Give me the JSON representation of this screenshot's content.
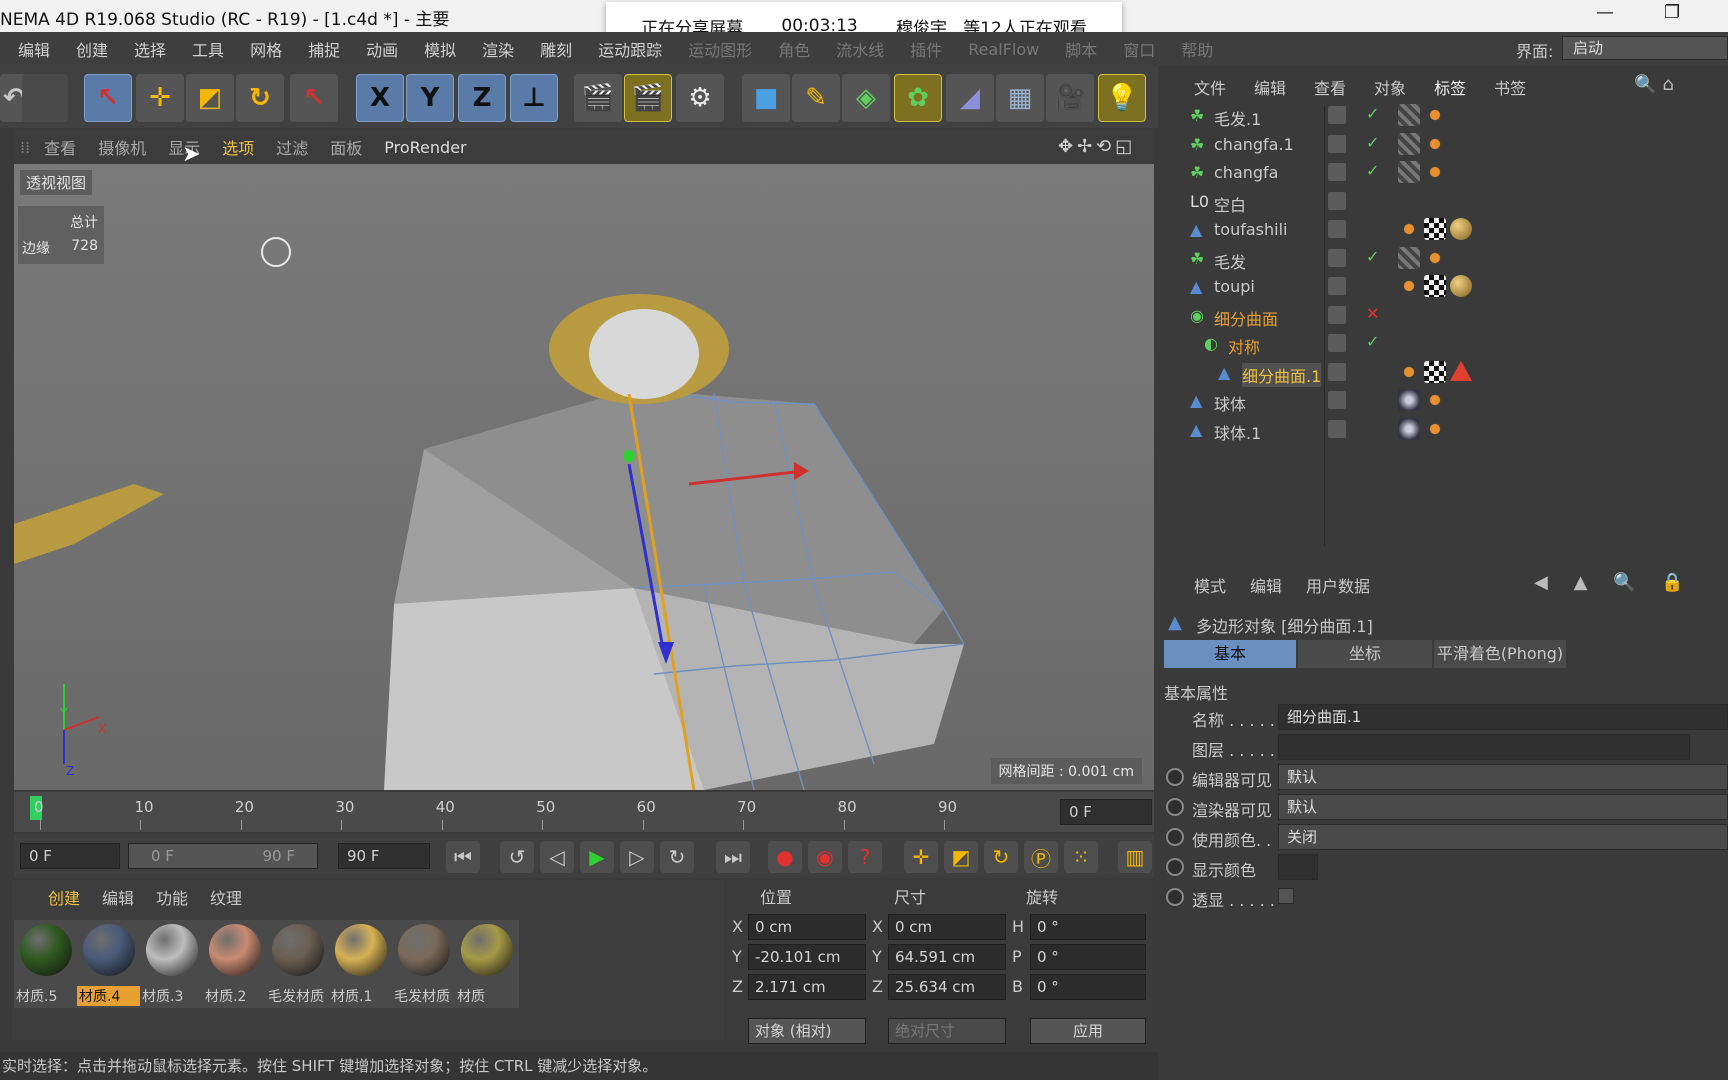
{
  "app": {
    "title": "NEMA 4D R19.068 Studio (RC - R19) - [1.c4d *] - 主要"
  },
  "share": {
    "status": "正在分享屏幕",
    "time": "00:03:13",
    "viewers": "穆俊宇...等12人正在观看"
  },
  "menu": {
    "items": [
      "编辑",
      "创建",
      "选择",
      "工具",
      "网格",
      "捕捉",
      "动画",
      "模拟",
      "渲染",
      "雕刻",
      "运动跟踪",
      "运动图形",
      "角色",
      "流水线",
      "插件",
      "RealFlow",
      "脚本",
      "窗口",
      "帮助"
    ],
    "interface_label": "界面:",
    "interface_value": "启动"
  },
  "toolbar": {
    "x_label": "X",
    "y_label": "Y",
    "z_label": "Z"
  },
  "viewport": {
    "menu": [
      "查看",
      "摄像机",
      "显示",
      "选项",
      "过滤",
      "面板",
      "ProRender"
    ],
    "view_label": "透视视图",
    "stats_total": "总计",
    "stats_edges_label": "边缘",
    "stats_edges_value": "728",
    "grid_spacing": "网格间距 : 0.001 cm",
    "axis_y": "Y",
    "axis_x": "X",
    "axis_z": "Z"
  },
  "timeline": {
    "ticks": [
      "0",
      "10",
      "20",
      "30",
      "40",
      "50",
      "60",
      "70",
      "80",
      "90"
    ],
    "current_frame": "0 F",
    "start": "0 F",
    "range_start": "0 F",
    "range_end": "90 F",
    "end": "90 F",
    "playhead_fraction": 0.0
  },
  "materials": {
    "menu": [
      "创建",
      "编辑",
      "功能",
      "纹理"
    ],
    "items": [
      {
        "label": "材质.5",
        "color": "#2f5a1f"
      },
      {
        "label": "材质.4",
        "color": "#4a5a7a",
        "selected": true
      },
      {
        "label": "材质.3",
        "color": "#bdbdbd"
      },
      {
        "label": "材质.2",
        "color": "#c98a72"
      },
      {
        "label": "毛发材质",
        "color": "#6b5e52"
      },
      {
        "label": "材质.1",
        "color": "#d7b255"
      },
      {
        "label": "毛发材质",
        "color": "#7a6a5a"
      },
      {
        "label": "材质",
        "color": "#a69a45"
      }
    ]
  },
  "coords": {
    "headers": [
      "位置",
      "尺寸",
      "旋转"
    ],
    "rows": [
      {
        "axis": "X",
        "pos": "0 cm",
        "size_axis": "X",
        "size": "0 cm",
        "rot_axis": "H",
        "rot": "0 °"
      },
      {
        "axis": "Y",
        "pos": "-20.101 cm",
        "size_axis": "Y",
        "size": "64.591 cm",
        "rot_axis": "P",
        "rot": "0 °"
      },
      {
        "axis": "Z",
        "pos": "2.171 cm",
        "size_axis": "Z",
        "size": "25.634 cm",
        "rot_axis": "B",
        "rot": "0 °"
      }
    ],
    "mode": "对象 (相对)",
    "size_mode": "绝对尺寸",
    "apply": "应用"
  },
  "status": {
    "text": "实时选择：点击并拖动鼠标选择元素。按住 SHIFT 键增加选择对象；按住 CTRL 键减少选择对象。"
  },
  "objects": {
    "menu": [
      "文件",
      "编辑",
      "查看",
      "对象",
      "标签",
      "书签"
    ],
    "items": [
      {
        "name": "毛发.1",
        "indent": 1,
        "icon": "hair",
        "color": "#c9c9c9",
        "check": true
      },
      {
        "name": "changfa.1",
        "indent": 1,
        "icon": "hair",
        "color": "#c9c9c9",
        "check": true
      },
      {
        "name": "changfa",
        "indent": 1,
        "icon": "hair",
        "color": "#c9c9c9",
        "check": true
      },
      {
        "name": "空白",
        "indent": 1,
        "icon": "null",
        "color": "#c9c9c9",
        "check": false
      },
      {
        "name": "toufashili",
        "indent": 1,
        "icon": "poly",
        "color": "#c9c9c9",
        "check": false
      },
      {
        "name": "毛发",
        "indent": 1,
        "icon": "hair",
        "color": "#c9c9c9",
        "check": true
      },
      {
        "name": "toupi",
        "indent": 1,
        "icon": "poly",
        "color": "#c9c9c9",
        "check": false
      },
      {
        "name": "细分曲面",
        "indent": 1,
        "icon": "subd",
        "color": "#e8a030",
        "check": false,
        "cross": true
      },
      {
        "name": "对称",
        "indent": 2,
        "icon": "sym",
        "color": "#e8a030",
        "check": true
      },
      {
        "name": "细分曲面.1",
        "indent": 3,
        "icon": "poly",
        "color": "#f0c040",
        "check": false,
        "selected": true
      },
      {
        "name": "球体",
        "indent": 1,
        "icon": "poly",
        "color": "#c9c9c9",
        "check": false
      },
      {
        "name": "球体.1",
        "indent": 1,
        "icon": "poly",
        "color": "#c9c9c9",
        "check": false
      }
    ]
  },
  "attributes": {
    "menu": [
      "模式",
      "编辑",
      "用户数据"
    ],
    "object_title": "多边形对象 [细分曲面.1]",
    "tabs": [
      "基本",
      "坐标",
      "平滑着色(Phong)"
    ],
    "section": "基本属性",
    "rows": [
      {
        "label": "名称 . . . . .",
        "value": "细分曲面.1"
      },
      {
        "label": "图层 . . . . .",
        "value": ""
      },
      {
        "label": "编辑器可见",
        "value": "默认"
      },
      {
        "label": "渲染器可见",
        "value": "默认"
      },
      {
        "label": "使用颜色. . .",
        "value": "关闭"
      },
      {
        "label": "显示颜色",
        "value": ""
      },
      {
        "label": "透显 . . . . .",
        "value": ""
      }
    ]
  }
}
